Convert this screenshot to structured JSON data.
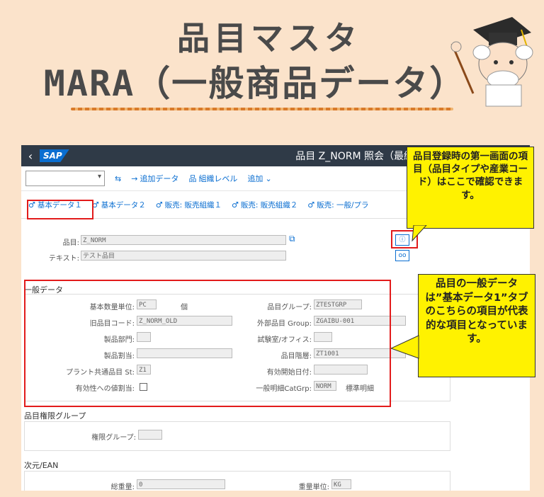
{
  "header": {
    "title_line1": "品目マスタ",
    "title_line2_prefix": "MARA",
    "title_line2_suffix": "（一般商品データ）"
  },
  "sap": {
    "window_title": "品目 Z_NORM 照会（最終製",
    "toolbar": {
      "additional_data": "追加データ",
      "org_levels": "組織レベル",
      "more": "追加"
    },
    "tabs": [
      "基本データ１",
      "基本データ２",
      "販売: 販売組織１",
      "販売: 販売組織２",
      "販売: 一般/プラ"
    ],
    "material": {
      "label": "品目:",
      "value": "Z_NORM",
      "text_label": "テキスト:",
      "text_value": "テスト品目"
    },
    "general": {
      "section": "一般データ",
      "base_unit_label": "基本数量単位:",
      "base_unit_value": "PC",
      "base_unit_text": "個",
      "old_material_label": "旧品目コード:",
      "old_material_value": "Z_NORM_OLD",
      "division_label": "製品部門:",
      "product_alloc_label": "製品割当:",
      "xplant_status_label": "プラント共通品目 St:",
      "xplant_status_value": "Z1",
      "assign_eff_label": "有効性への値割当:",
      "mat_group_label": "品目グループ:",
      "mat_group_value": "ZTESTGRP",
      "ext_group_label": "外部品目 Group:",
      "ext_group_value": "ZGAIBU-001",
      "lab_label": "試験室/オフィス:",
      "hierarchy_label": "品目階層:",
      "hierarchy_value": "ZT1001",
      "valid_from_label": "有効開始日付:",
      "gen_item_cat_label": "一般明細CatGrp:",
      "gen_item_cat_value": "NORM",
      "gen_item_cat_text": "標準明細"
    },
    "auth": {
      "section": "品目権限グループ",
      "group_label": "権限グループ:"
    },
    "dims": {
      "section": "次元/EAN",
      "gross_weight_label": "総重量:",
      "gross_weight_value": "0",
      "weight_unit_label": "重量単位:",
      "weight_unit_value": "KG"
    }
  },
  "callouts": {
    "top": "品目登録時の第一画面の項目（品目タイプや産業コード）はここで確認できます。",
    "bottom": "品目の一般データは”基本データ1”タブのこちらの項目が代表的な項目となっています。"
  },
  "colors": {
    "background": "#fbe3cb",
    "shell": "#2f3a47",
    "sap_blue": "#0a6ed1",
    "callout": "#fff200",
    "highlight": "#e21b1b",
    "title": "#4a4a4a"
  },
  "icons": [
    "chevron-back-icon",
    "chevron-down-icon",
    "display-icon",
    "arrow-right-icon",
    "org-levels-icon",
    "info-icon",
    "glasses-icon",
    "copy-icon",
    "tab-icon"
  ]
}
